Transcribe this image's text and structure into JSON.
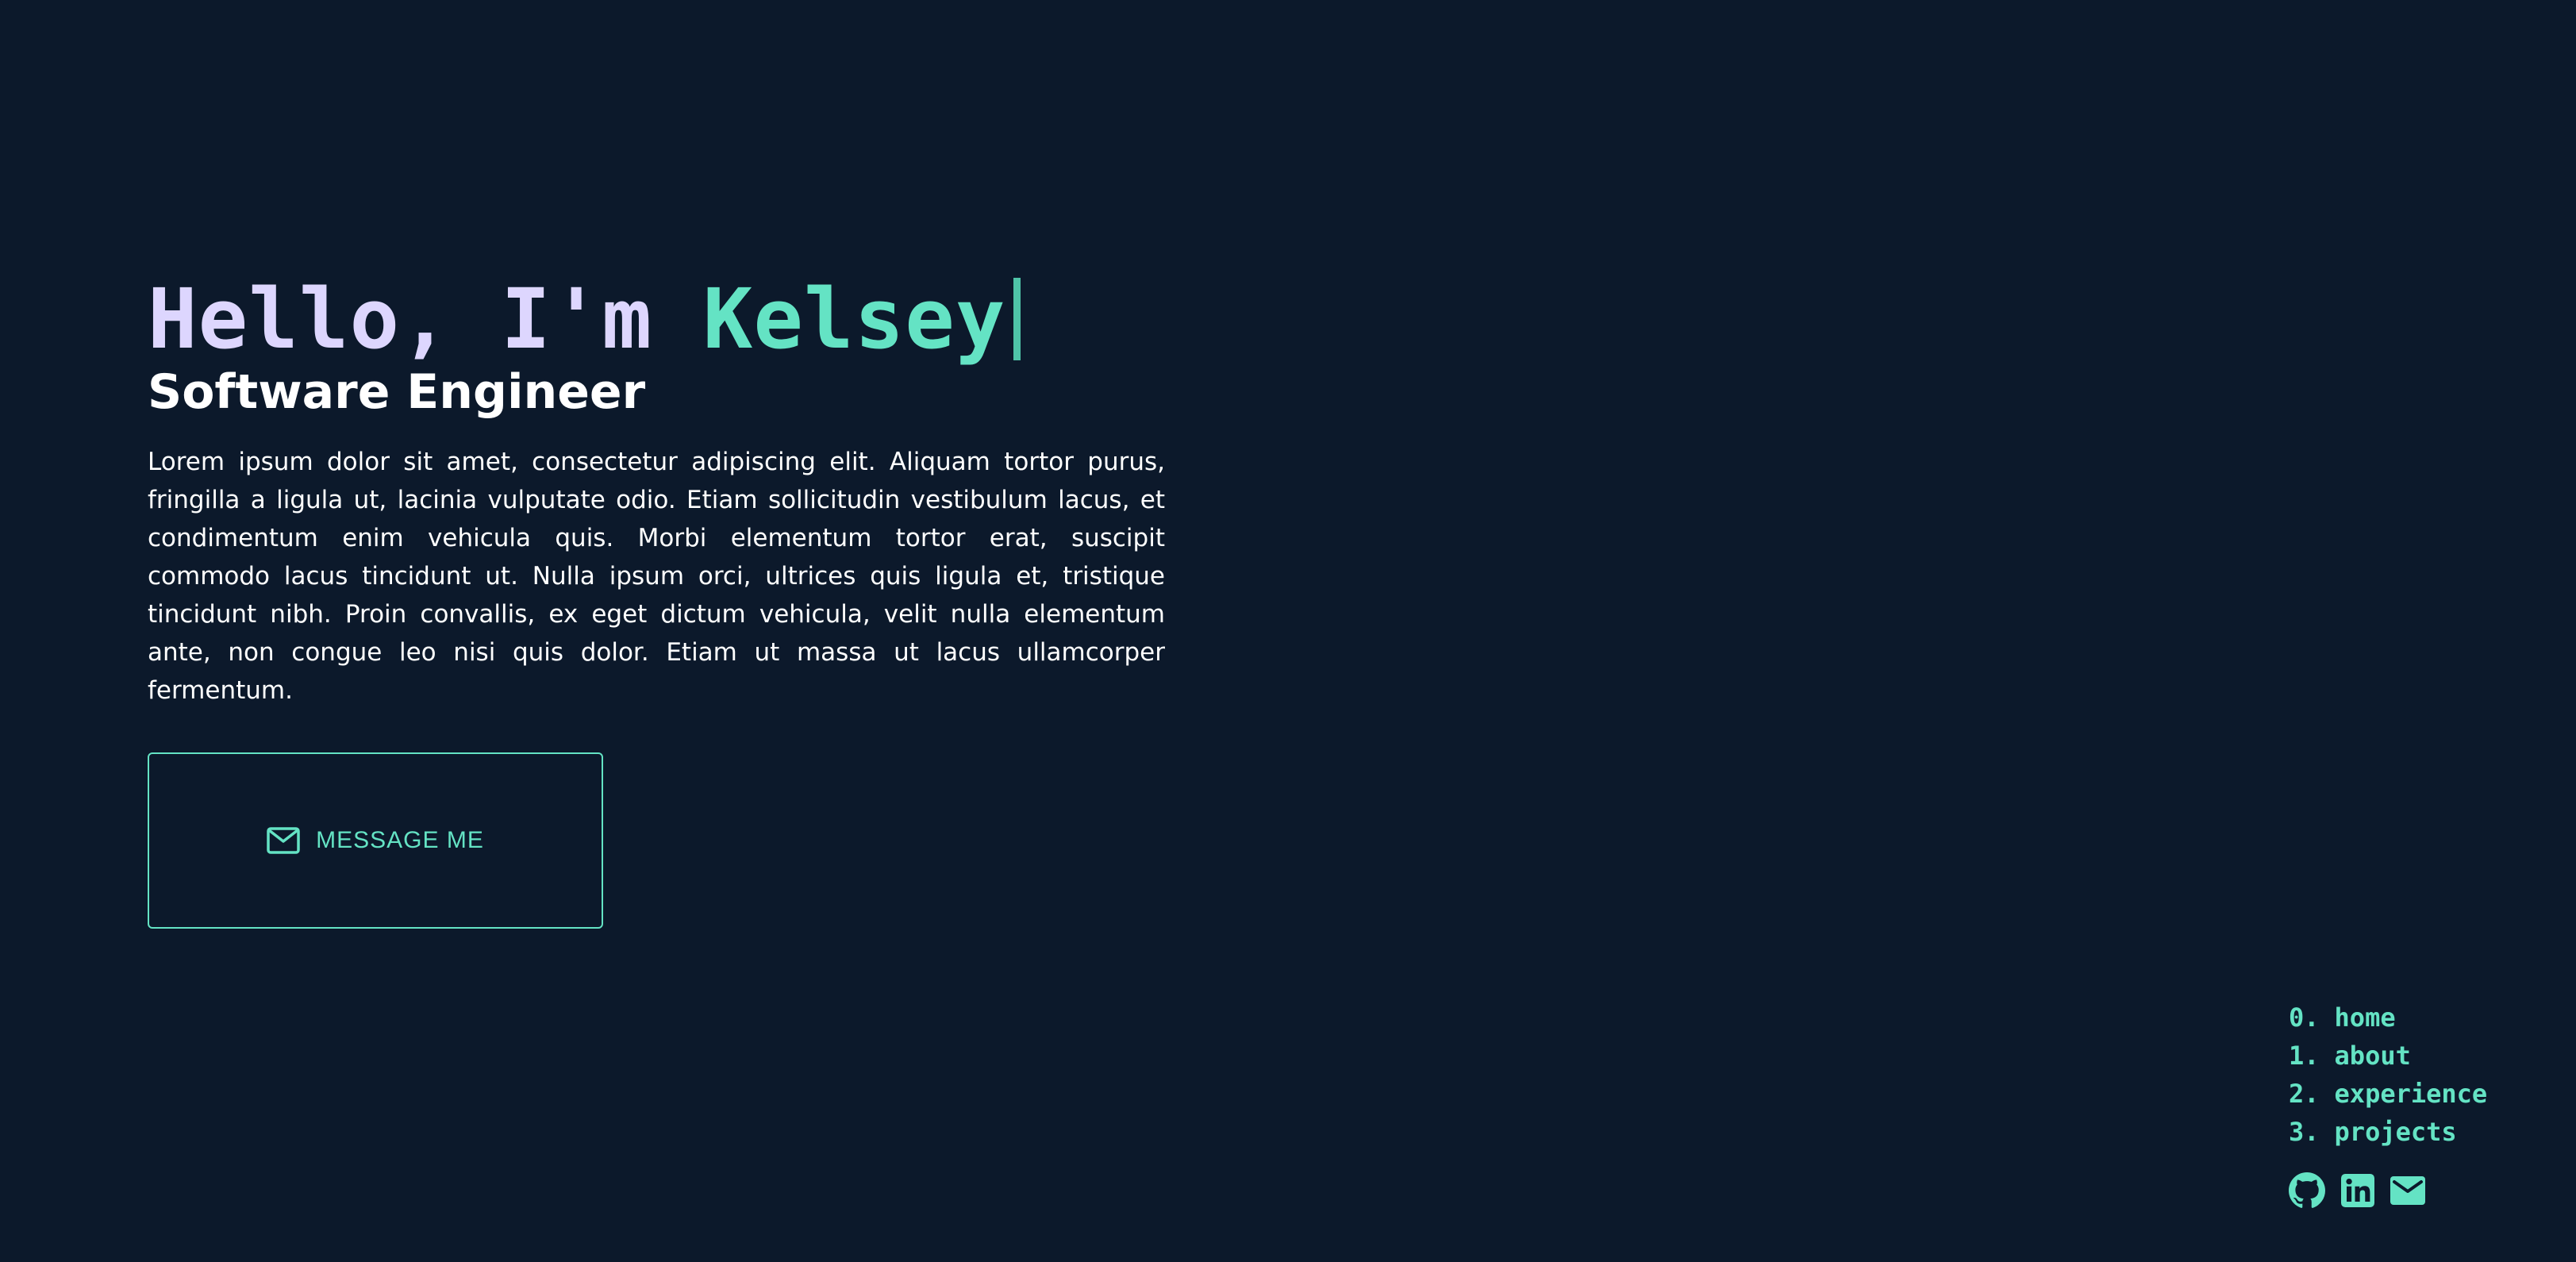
{
  "hero": {
    "greeting": "Hello, I'm ",
    "name": "Kelsey",
    "subtitle": "Software Engineer",
    "bio": "Lorem ipsum dolor sit amet, consectetur adipiscing elit. Aliquam tortor purus, fringilla a ligula ut, lacinia vulputate odio. Etiam sollicitudin vestibulum lacus, et condimentum enim vehicula quis. Morbi elementum tortor erat, suscipit commodo lacus tincidunt ut. Nulla ipsum orci, ultrices quis ligula et, tristique tincidunt nibh. Proin convallis, ex eget dictum vehicula, velit nulla elementum ante, non congue leo nisi quis dolor. Etiam ut massa ut lacus ullamcorper fermentum."
  },
  "cta": {
    "icon": "mail-icon",
    "label": "MESSAGE ME"
  },
  "nav": {
    "items": [
      {
        "num": "0.",
        "label": "home"
      },
      {
        "num": "1.",
        "label": "about"
      },
      {
        "num": "2.",
        "label": "experience"
      },
      {
        "num": "3.",
        "label": "projects"
      }
    ]
  },
  "socials": {
    "icons": [
      "github-icon",
      "linkedin-icon",
      "email-icon"
    ]
  },
  "colors": {
    "background": "#0c192b",
    "accent": "#64e3c4",
    "greeting": "#ddd6fe",
    "text": "#ffffff"
  }
}
